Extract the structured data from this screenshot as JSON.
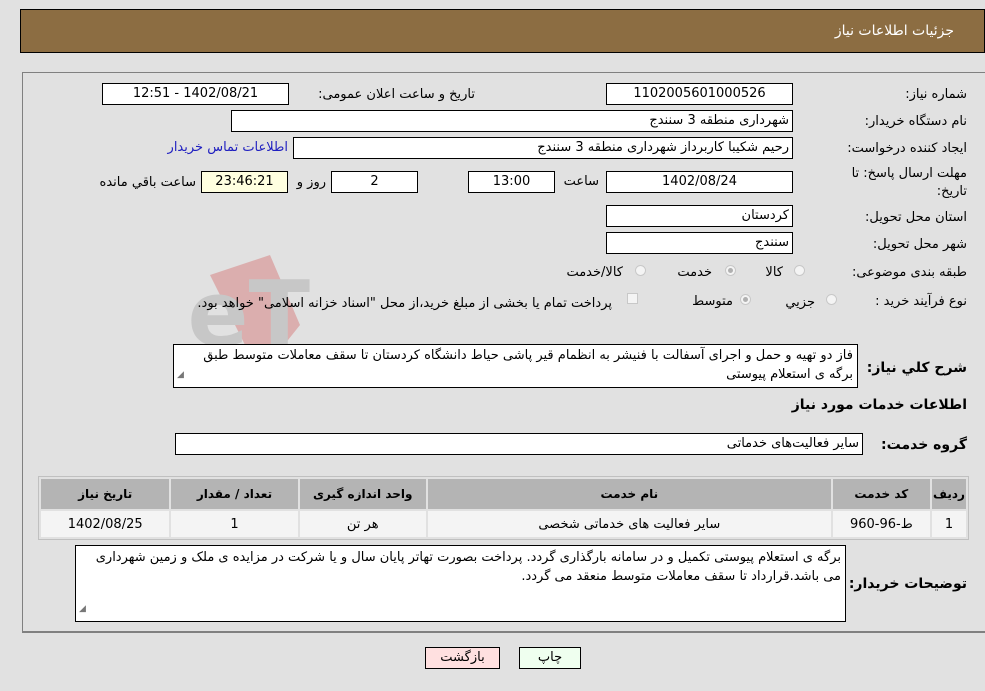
{
  "header": {
    "title": "جزئیات اطلاعات نیاز"
  },
  "form": {
    "need_number": {
      "label": "شماره نیاز:",
      "value": "1102005601000526"
    },
    "announce_datetime": {
      "label": "تاریخ و ساعت اعلان عمومی:",
      "value": "1402/08/21 - 12:51"
    },
    "buyer_org": {
      "label": "نام دستگاه خریدار:",
      "value": "شهرداری منطقه 3 سنندج"
    },
    "requester": {
      "label": "ایجاد کننده درخواست:",
      "value": "رحیم شکیبا کاربرداز شهرداری منطقه 3 سنندج"
    },
    "buyer_contact_link": "اطلاعات تماس خریدار",
    "deadline": {
      "label_line1": "مهلت ارسال پاسخ: تا",
      "label_line2": "تاریخ:",
      "date": "1402/08/24",
      "time_label": "ساعت",
      "time": "13:00",
      "days": "2",
      "days_label": "روز و",
      "remaining": "23:46:21",
      "remaining_label": "ساعت باقي مانده"
    },
    "province": {
      "label": "استان محل تحویل:",
      "value": "کردستان"
    },
    "city": {
      "label": "شهر محل تحویل:",
      "value": "سنندج"
    },
    "category": {
      "label": "طبقه بندی موضوعی:",
      "options": [
        "کالا",
        "خدمت",
        "کالا/خدمت"
      ],
      "selected": "خدمت"
    },
    "purchase_type": {
      "label": "نوع فرآیند خرید :",
      "options": [
        "جزيي",
        "متوسط"
      ],
      "selected": "متوسط",
      "payment_checkbox_label": "پرداخت تمام یا بخشی از مبلغ خرید،از محل \"اسناد خزانه اسلامی\" خواهد بود.",
      "payment_checked": false
    }
  },
  "description": {
    "label": "شرح کلي نیاز:",
    "value": "فاز دو تهیه و حمل و اجرای آسفالت با فنیشر به انظمام قیر پاشی حیاط دانشگاه کردستان تا سقف معاملات متوسط طبق برگه ی استعلام پیوستی"
  },
  "services_section_title": "اطلاعات خدمات مورد نیاز",
  "service_group": {
    "label": "گروه خدمت:",
    "value": "سایر فعالیت‌های خدماتی"
  },
  "table": {
    "headers": [
      "ردیف",
      "کد خدمت",
      "نام خدمت",
      "واحد اندازه گیری",
      "تعداد / مقدار",
      "تاریخ نیاز"
    ],
    "rows": [
      [
        "1",
        "ط-96-960",
        "سایر فعالیت های خدماتی شخصی",
        "هر تن",
        "1",
        "1402/08/25"
      ]
    ]
  },
  "buyer_notes": {
    "label": "توضیحات خریدار:",
    "value": "برگه ی استعلام پیوستی تکمیل و در سامانه بارگذاری گردد. پرداخت بصورت تهاتر پایان سال و یا شرکت در مزایده ی ملک و زمین شهرداری می باشد.قرارداد تا سقف معاملات متوسط منعقد می گردد."
  },
  "buttons": {
    "print": "چاپ",
    "back": "بازگشت"
  },
  "colors": {
    "header_bg": "#8c6d42",
    "print_bg": "#efffef",
    "back_bg": "#ffe0e0",
    "link": "#2020c0"
  }
}
